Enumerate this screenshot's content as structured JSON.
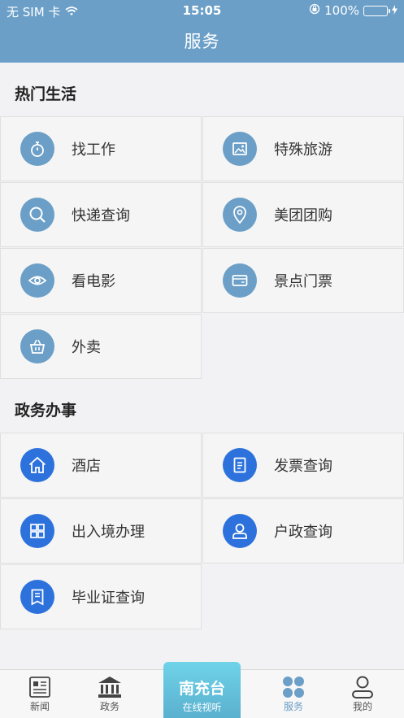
{
  "status": {
    "carrier": "无 SIM 卡",
    "time": "15:05",
    "battery": "100%",
    "battery_color": "#4cd964"
  },
  "nav": {
    "title": "服务"
  },
  "sections": [
    {
      "title": "热门生活",
      "items": [
        {
          "label": "找工作",
          "icon": "stopwatch-icon"
        },
        {
          "label": "特殊旅游",
          "icon": "image-icon"
        },
        {
          "label": "快递查询",
          "icon": "search-icon"
        },
        {
          "label": "美团团购",
          "icon": "location-pin-icon"
        },
        {
          "label": "看电影",
          "icon": "eye-icon"
        },
        {
          "label": "景点门票",
          "icon": "wallet-icon"
        },
        {
          "label": "外卖",
          "icon": "basket-icon"
        }
      ]
    },
    {
      "title": "政务办事",
      "items": [
        {
          "label": "酒店",
          "icon": "home-icon"
        },
        {
          "label": "发票查询",
          "icon": "document-icon"
        },
        {
          "label": "出入境办理",
          "icon": "grid-icon"
        },
        {
          "label": "户政查询",
          "icon": "person-icon"
        },
        {
          "label": "毕业证查询",
          "icon": "bookmark-doc-icon"
        }
      ]
    }
  ],
  "tabbar": {
    "tabs": [
      {
        "label": "新闻",
        "icon": "newspaper-icon"
      },
      {
        "label": "政务",
        "icon": "government-building-icon"
      },
      {
        "label": "服务",
        "icon": "clover-icon"
      },
      {
        "label": "我的",
        "icon": "user-icon"
      }
    ],
    "center": {
      "title": "南充台",
      "subtitle": "在线视听"
    },
    "active_color": "#6b9fc7"
  },
  "colors": {
    "header": "#6b9fc7",
    "life_icon": "#6b9fc7",
    "gov_icon": "#2d72dc"
  }
}
